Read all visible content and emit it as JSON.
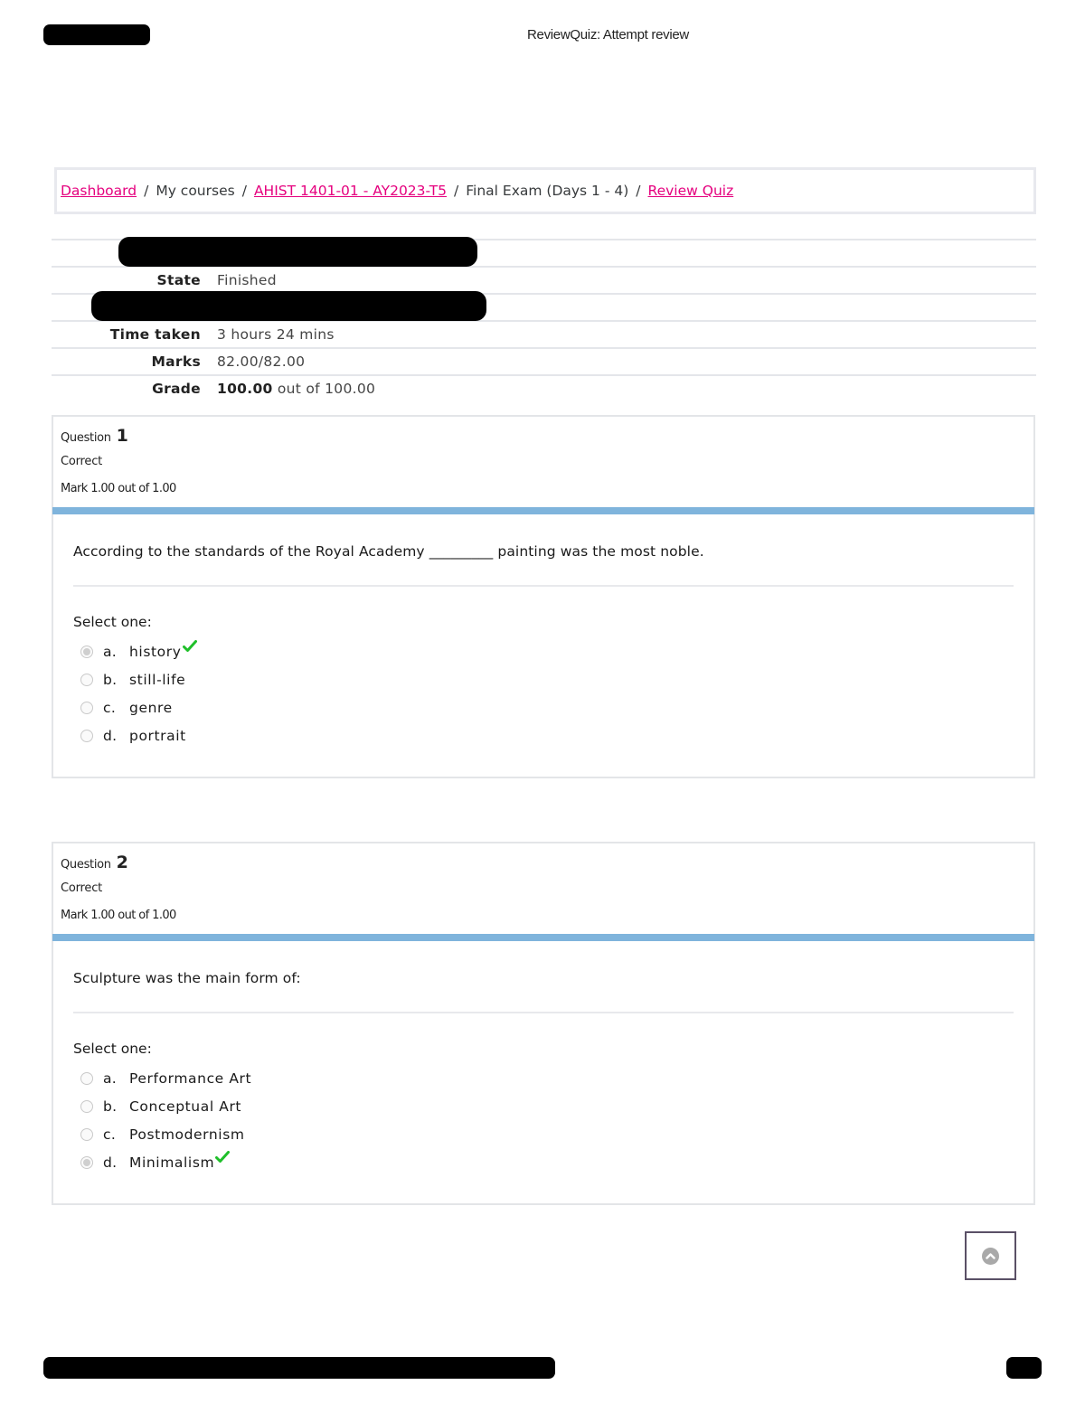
{
  "header": {
    "print_title": "ReviewQuiz: Attempt review"
  },
  "breadcrumb": {
    "items": [
      {
        "label": "Dashboard",
        "link": true
      },
      {
        "label": "My courses",
        "link": false
      },
      {
        "label": "AHIST 1401-01 - AY2023-T5",
        "link": true
      },
      {
        "label": "Final Exam (Days 1 - 4)",
        "link": false
      },
      {
        "label": "Review Quiz",
        "link": true
      }
    ],
    "separator": "/"
  },
  "summary": {
    "state_label": "State",
    "state_value": "Finished",
    "time_label": "Time taken",
    "time_value": "3 hours 24 mins",
    "marks_label": "Marks",
    "marks_value": "82.00/82.00",
    "grade_label": "Grade",
    "grade_score": "100.00",
    "grade_suffix": "out of 100.00"
  },
  "questions": [
    {
      "prefix": "Question",
      "number": "1",
      "state": "Correct",
      "grade": "Mark 1.00 out of 1.00",
      "text": "According to the standards of the Royal Academy _________ painting was the most noble.",
      "prompt": "Select one:",
      "answers": [
        {
          "letter": "a.",
          "text": "history",
          "selected": true,
          "correct": true
        },
        {
          "letter": "b.",
          "text": "still-life",
          "selected": false,
          "correct": false
        },
        {
          "letter": "c.",
          "text": "genre",
          "selected": false,
          "correct": false
        },
        {
          "letter": "d.",
          "text": "portrait",
          "selected": false,
          "correct": false
        }
      ]
    },
    {
      "prefix": "Question",
      "number": "2",
      "state": "Correct",
      "grade": "Mark 1.00 out of 1.00",
      "text": "Sculpture was the main form of:",
      "prompt": "Select one:",
      "answers": [
        {
          "letter": "a.",
          "text": "Performance Art",
          "selected": false,
          "correct": false
        },
        {
          "letter": "b.",
          "text": "Conceptual Art",
          "selected": false,
          "correct": false
        },
        {
          "letter": "c.",
          "text": "Postmodernism",
          "selected": false,
          "correct": false
        },
        {
          "letter": "d.",
          "text": "Minimalism",
          "selected": true,
          "correct": true
        }
      ]
    }
  ],
  "icons": {
    "correct": "check-icon",
    "scroll_top": "chevron-up-icon"
  },
  "colors": {
    "link": "#e5007e",
    "question_bar": "#7fb4dc",
    "correct_check": "#1fbf2a"
  }
}
